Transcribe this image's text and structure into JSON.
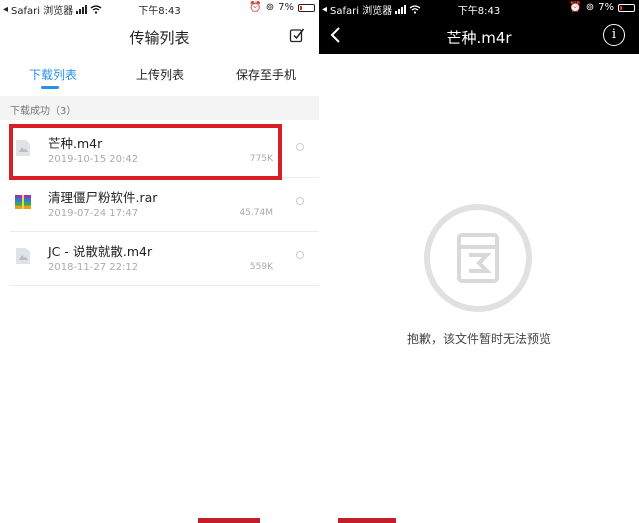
{
  "left": {
    "status": {
      "carrier": "Safari 浏览器",
      "time": "下午8:43",
      "battery": "7%"
    },
    "title": "传输列表",
    "tabs": [
      "下载列表",
      "上传列表",
      "保存至手机"
    ],
    "section": "下载成功（3）",
    "files": [
      {
        "name": "芒种.m4r",
        "date": "2019-10-15 20:42",
        "size": "775K",
        "icon": "audio-file-icon"
      },
      {
        "name": "清理僵尸粉软件.rar",
        "date": "2019-07-24 17:47",
        "size": "45.74M",
        "icon": "archive-file-icon"
      },
      {
        "name": "JC - 说散就散.m4r",
        "date": "2018-11-27 22:12",
        "size": "559K",
        "icon": "audio-file-icon"
      }
    ]
  },
  "right": {
    "status": {
      "carrier": "Safari 浏览器",
      "time": "下午8:43",
      "battery": "7%"
    },
    "title": "芒种.m4r",
    "info": "i",
    "message": "抱歉，该文件暂时无法预览"
  },
  "colors": {
    "accent": "#2a8fe6",
    "highlight": "#d81f26",
    "header_dark": "#000000"
  }
}
